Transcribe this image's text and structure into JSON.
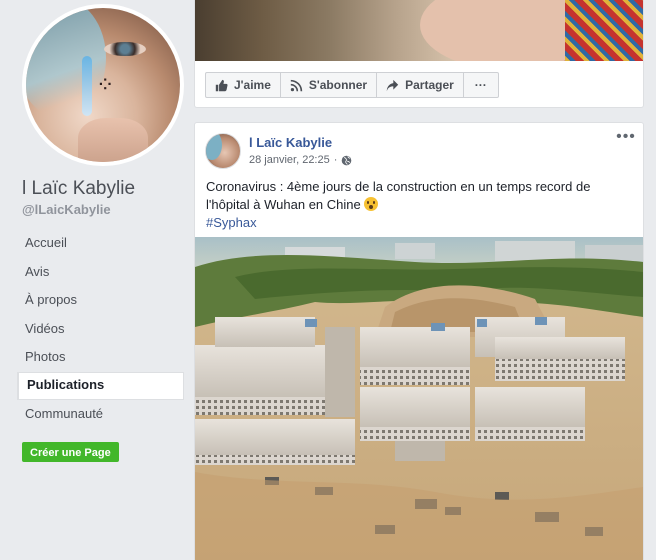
{
  "sidebar": {
    "page_name": "l Laïc Kabylie",
    "page_handle": "@lLaicKabylie",
    "nav": [
      {
        "label": "Accueil",
        "active": false
      },
      {
        "label": "Avis",
        "active": false
      },
      {
        "label": "À propos",
        "active": false
      },
      {
        "label": "Vidéos",
        "active": false
      },
      {
        "label": "Photos",
        "active": false
      },
      {
        "label": "Publications",
        "active": true
      },
      {
        "label": "Communauté",
        "active": false
      }
    ],
    "create_page_label": "Créer une Page"
  },
  "top_post_actions": {
    "like_label": "J'aime",
    "subscribe_label": "S'abonner",
    "share_label": "Partager",
    "more_label": "···"
  },
  "post": {
    "author": "l Laïc Kabylie",
    "date": "28 janvier, 22:25",
    "separator": "·",
    "more_label": "•••",
    "text": "Coronavirus : 4ème jours de la construction en un temps record de l'hôpital à Wuhan en Chine",
    "hashtag": "#Syphax",
    "icons": {
      "privacy": "globe-icon",
      "emoji": "astonished-face-emoji"
    }
  },
  "colors": {
    "link_blue": "#385898",
    "create_green": "#42b72a",
    "background": "#e9ebee"
  }
}
